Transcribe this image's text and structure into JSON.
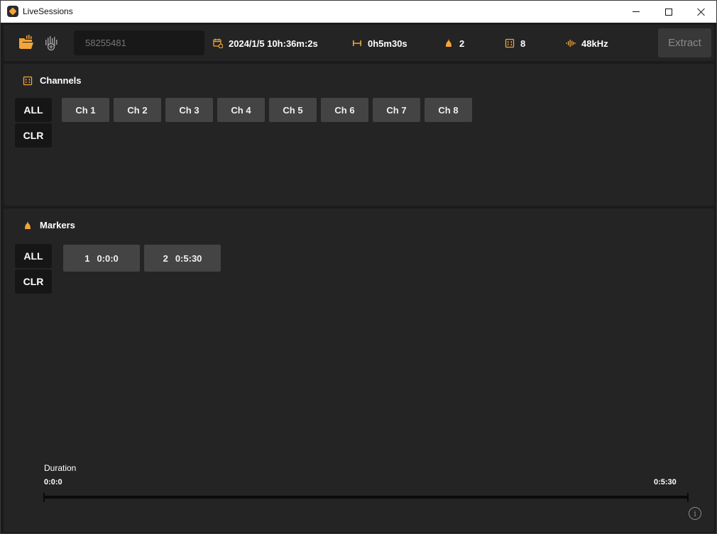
{
  "window": {
    "title": "LiveSessions"
  },
  "toolbar": {
    "session_placeholder": "58255481",
    "date": "2024/1/5 10h:36m:2s",
    "duration": "0h5m30s",
    "marker_count": "2",
    "channel_count": "8",
    "sample_rate": "48kHz",
    "extract_label": "Extract"
  },
  "channels": {
    "title": "Channels",
    "all_label": "ALL",
    "clr_label": "CLR",
    "items": [
      "Ch 1",
      "Ch 2",
      "Ch 3",
      "Ch 4",
      "Ch 5",
      "Ch 6",
      "Ch 7",
      "Ch 8"
    ]
  },
  "markers": {
    "title": "Markers",
    "all_label": "ALL",
    "clr_label": "CLR",
    "items": [
      {
        "index": "1",
        "time": "0:0:0"
      },
      {
        "index": "2",
        "time": "0:5:30"
      }
    ]
  },
  "duration": {
    "label": "Duration",
    "start": "0:0:0",
    "end": "0:5:30"
  },
  "colors": {
    "accent": "#f3a43a",
    "background": "#1b1b1b",
    "panel": "#242424",
    "button": "#444444",
    "select_button": "#161616"
  },
  "icons": {
    "open": "folder-open-icon",
    "record": "waveform-plus-icon",
    "date": "calendar-clock-icon",
    "duration": "duration-span-icon",
    "markers": "marker-bell-icon",
    "channels": "channels-grid-icon",
    "sample_rate": "waveform-icon",
    "info": "info-icon"
  }
}
